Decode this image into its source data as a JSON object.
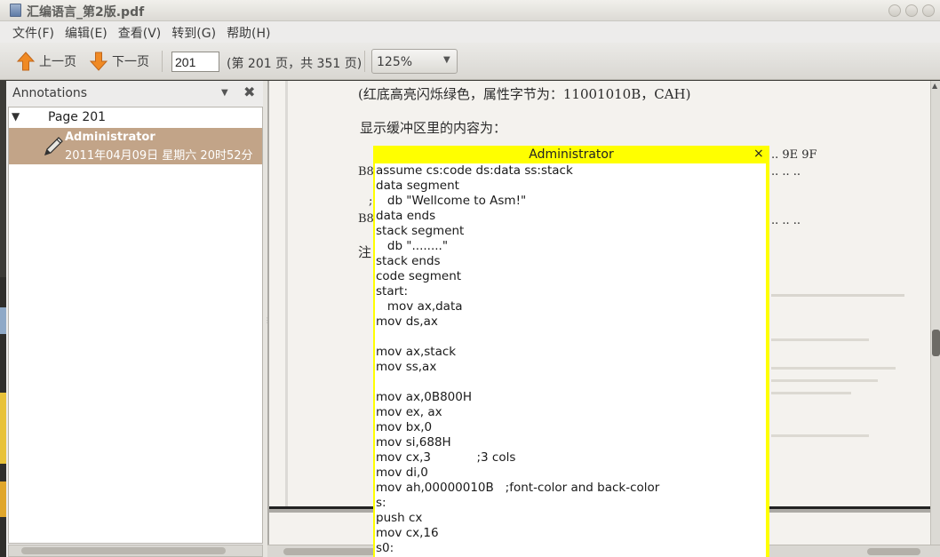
{
  "window": {
    "title": "汇编语言_第2版.pdf"
  },
  "menu": [
    "文件(F)",
    "编辑(E)",
    "查看(V)",
    "转到(G)",
    "帮助(H)"
  ],
  "toolbar": {
    "prev_label": "上一页",
    "next_label": "下一页",
    "page_value": "201",
    "page_info": "(第 201 页，共 351 页)",
    "zoom": "125%"
  },
  "sidebar": {
    "title": "Annotations",
    "page_label": "Page 201",
    "annotation_author": "Administrator",
    "annotation_date": "2011年04月09日 星期六 20时52分"
  },
  "document": {
    "line1": "(红底高亮闪烁绿色，属性字节为：11001010B，CAH)",
    "line2": "显示缓冲区里的内容为：",
    "left_b8a": "B8",
    "left_semicolon": ";",
    "left_b8b": "B8",
    "left_zhu": "注",
    "right_hex": "..  9E  9F",
    "right_dots1": "..  ..  ..",
    "right_dots2": "..  ..  .."
  },
  "popup": {
    "title": "Administrator",
    "close": "×",
    "lines": [
      "assume cs:code ds:data ss:stack",
      "data segment",
      "   db \"Wellcome to Asm!\"",
      "data ends",
      "stack segment",
      "   db \"........\"",
      "stack ends",
      "code segment",
      "start:",
      "   mov ax,data",
      "mov ds,ax",
      "",
      "mov ax,stack",
      "mov ss,ax",
      "",
      "mov ax,0B800H",
      "mov ex, ax",
      "mov bx,0",
      "mov si,688H",
      "mov cx,3            ;3 cols",
      "mov di,0",
      "mov ah,00000010B   ;font-color and back-color",
      "s:",
      "push cx",
      "mov cx,16",
      "s0:"
    ]
  }
}
